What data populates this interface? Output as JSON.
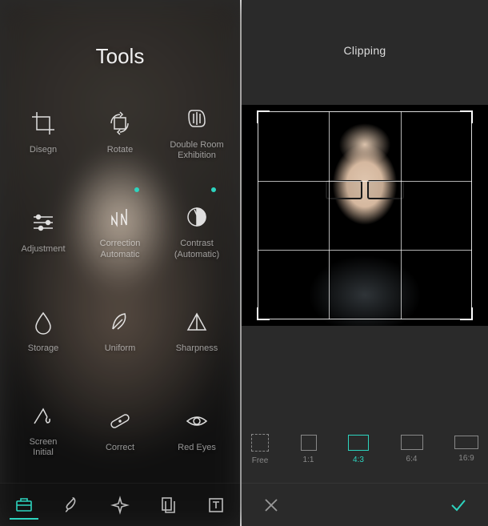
{
  "left": {
    "title": "Tools",
    "tools": [
      {
        "label": "Disegn",
        "icon": "crop-icon"
      },
      {
        "label": "Rotate",
        "icon": "rotate-icon"
      },
      {
        "label": "Double Room\nExhibition",
        "icon": "double-exposure-icon"
      },
      {
        "label": "Adjustment",
        "icon": "sliders-icon"
      },
      {
        "label": "Correction\nAutomatic",
        "icon": "auto-correct-icon",
        "badge": true
      },
      {
        "label": "Contrast\n(Automatic)",
        "icon": "contrast-icon",
        "badge": true
      },
      {
        "label": "Storage",
        "icon": "drop-icon"
      },
      {
        "label": "Uniform",
        "icon": "feather-icon"
      },
      {
        "label": "Sharpness",
        "icon": "triangle-icon"
      },
      {
        "label": "Screen\nInitial",
        "icon": "splash-icon"
      },
      {
        "label": "Correct",
        "icon": "bandage-icon"
      },
      {
        "label": "Red Eyes",
        "icon": "eye-icon"
      }
    ],
    "tabs": [
      {
        "name": "toolbox-tab",
        "icon": "toolbox-icon",
        "active": true
      },
      {
        "name": "brush-tab",
        "icon": "brush-icon"
      },
      {
        "name": "effects-tab",
        "icon": "sparkle-icon"
      },
      {
        "name": "layers-tab",
        "icon": "pages-icon"
      },
      {
        "name": "text-tab",
        "icon": "text-icon"
      }
    ]
  },
  "right": {
    "title": "Clipping",
    "ratios": [
      {
        "label": "Free",
        "shape": "free"
      },
      {
        "label": "1:1",
        "shape": "sq"
      },
      {
        "label": "4:3",
        "shape": "r43",
        "active": true
      },
      {
        "label": "6:4",
        "shape": "r64"
      },
      {
        "label": "16:9",
        "shape": "r169"
      }
    ]
  }
}
